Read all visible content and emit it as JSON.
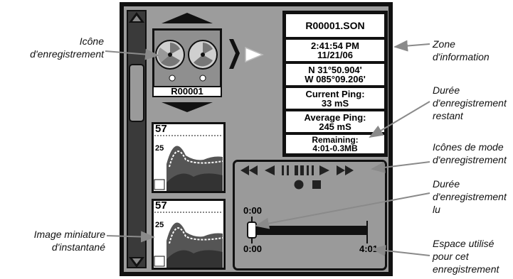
{
  "recording": {
    "name": "R00001"
  },
  "info": {
    "file_name": "R00001.SON",
    "time": "2:41:54  PM",
    "date": "11/21/06",
    "lat": "N  31°50.904'",
    "lon": "W  085°09.206'",
    "current_ping_label": "Current Ping:",
    "current_ping_value": "33  mS",
    "average_ping_label": "Average Ping:",
    "average_ping_value": "245  mS",
    "remaining_label": "Remaining:",
    "remaining_value": "4:01-0.3MB"
  },
  "thumbnails": [
    {
      "depth_top": "57",
      "depth_mid": "25"
    },
    {
      "depth_top": "57",
      "depth_mid": "25"
    }
  ],
  "playback": {
    "position_time": "0:00",
    "start_time": "0:00",
    "end_time": "4:01",
    "progress": 0.0
  },
  "callouts": {
    "record_icon": [
      "Icône",
      "d'enregistrement"
    ],
    "thumbnail": [
      "Image miniature",
      "d'instantané"
    ],
    "info_zone": [
      "Zone",
      "d'information"
    ],
    "remaining": [
      "Durée",
      "d'enregistrement",
      "restant"
    ],
    "mode_icons": [
      "Icônes de mode",
      "d'enregistrement"
    ],
    "played": [
      "Durée",
      "d'enregistrement",
      "lu"
    ],
    "space_used": [
      "Espace utilisé",
      "pour cet",
      "enregistrement"
    ]
  }
}
